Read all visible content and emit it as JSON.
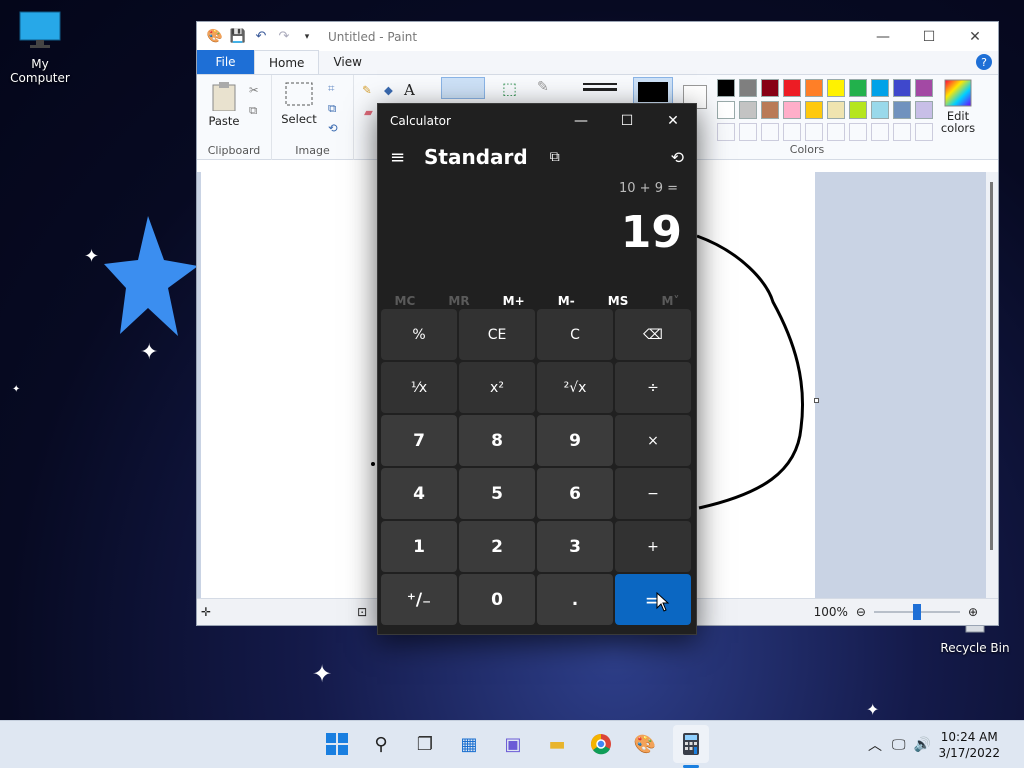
{
  "desktop": {
    "icons": [
      {
        "label": "My Computer",
        "icon": "monitor-icon"
      },
      {
        "label": "Recycle Bin",
        "icon": "recycle-bin-icon"
      }
    ]
  },
  "paint": {
    "window_title": "Untitled - Paint",
    "tabs": [
      "File",
      "Home",
      "View"
    ],
    "ribbon": {
      "clipboard": {
        "paste_label": "Paste",
        "group_label": "Clipboard"
      },
      "image": {
        "select_label": "Select",
        "group_label": "Image"
      },
      "colors": {
        "edit_colors_label": "Edit colors",
        "group_label": "Colors"
      }
    },
    "palette_row1": [
      "#000000",
      "#7f7f7f",
      "#880015",
      "#ed1c24",
      "#ff7f27",
      "#fff200",
      "#22b14c",
      "#00a2e8",
      "#3f48cc",
      "#a349a4"
    ],
    "palette_row2": [
      "#ffffff",
      "#c3c3c3",
      "#b97a57",
      "#ffaec9",
      "#ffc90e",
      "#efe4b0",
      "#b5e61d",
      "#99d9ea",
      "#7092be",
      "#c8bfe7"
    ],
    "status": {
      "zoom": "100%",
      "zoom_level": 1.0
    }
  },
  "calculator": {
    "title": "Calculator",
    "mode": "Standard",
    "expression": "10 + 9 =",
    "result": "19",
    "memory": {
      "mc": "MC",
      "mr": "MR",
      "mplus": "M+",
      "mminus": "M-",
      "ms": "MS",
      "mlist": "M˅"
    },
    "keys": [
      {
        "label": "%",
        "type": "op",
        "name": "percent-button"
      },
      {
        "label": "CE",
        "type": "op",
        "name": "clear-entry-button"
      },
      {
        "label": "C",
        "type": "op",
        "name": "clear-button"
      },
      {
        "label": "⌫",
        "type": "op",
        "name": "backspace-button"
      },
      {
        "label": "⅟x",
        "type": "op",
        "name": "reciprocal-button"
      },
      {
        "label": "x²",
        "type": "op",
        "name": "square-button"
      },
      {
        "label": "²√x",
        "type": "op",
        "name": "square-root-button"
      },
      {
        "label": "÷",
        "type": "op",
        "name": "divide-button"
      },
      {
        "label": "7",
        "type": "num",
        "name": "digit-7-button"
      },
      {
        "label": "8",
        "type": "num",
        "name": "digit-8-button"
      },
      {
        "label": "9",
        "type": "num",
        "name": "digit-9-button"
      },
      {
        "label": "×",
        "type": "op",
        "name": "multiply-button"
      },
      {
        "label": "4",
        "type": "num",
        "name": "digit-4-button"
      },
      {
        "label": "5",
        "type": "num",
        "name": "digit-5-button"
      },
      {
        "label": "6",
        "type": "num",
        "name": "digit-6-button"
      },
      {
        "label": "−",
        "type": "op",
        "name": "subtract-button"
      },
      {
        "label": "1",
        "type": "num",
        "name": "digit-1-button"
      },
      {
        "label": "2",
        "type": "num",
        "name": "digit-2-button"
      },
      {
        "label": "3",
        "type": "num",
        "name": "digit-3-button"
      },
      {
        "label": "+",
        "type": "op",
        "name": "add-button"
      },
      {
        "label": "⁺∕₋",
        "type": "num",
        "name": "negate-button"
      },
      {
        "label": "0",
        "type": "num",
        "name": "digit-0-button"
      },
      {
        "label": ".",
        "type": "num",
        "name": "decimal-button"
      },
      {
        "label": "=",
        "type": "eq",
        "name": "equals-button"
      }
    ]
  },
  "taskbar": {
    "clock_time": "10:24 AM",
    "clock_date": "3/17/2022"
  }
}
